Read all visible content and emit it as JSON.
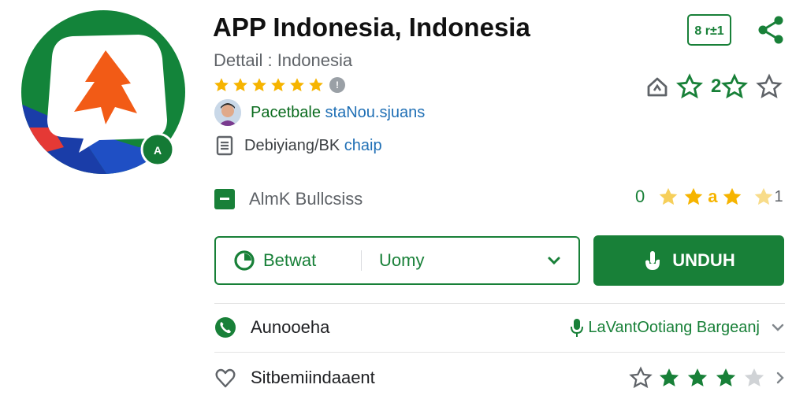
{
  "app": {
    "title": "APP Indonesia, Indonesia",
    "subtitle": "Dettail : Indonesia",
    "star_rating": 6,
    "info_icon_label": "!"
  },
  "developer": {
    "name_green": "Pacetbale",
    "name_blue": "staNou.sjuans"
  },
  "category": {
    "text": "Debiyiang/BK",
    "link": "chaip"
  },
  "header_actions": {
    "age_rating": "8 r±1",
    "rating_value": "2"
  },
  "feature": {
    "label": "AlmK Bullcsiss",
    "count": "0",
    "mid_text": "a",
    "tail": "1"
  },
  "buttons": {
    "select_primary": "Betwat",
    "select_secondary": "Uomy",
    "download": "UNDUH"
  },
  "rows": [
    {
      "label": "Aunooeha",
      "value": "LaVantOotiang Bargeanj"
    },
    {
      "label": "Sitbemiindaaent",
      "stars_filled": 3,
      "stars_total": 4
    }
  ],
  "colors": {
    "brand_green": "#188038",
    "star_gold": "#F6B400",
    "link_blue": "#1f6fb5"
  }
}
